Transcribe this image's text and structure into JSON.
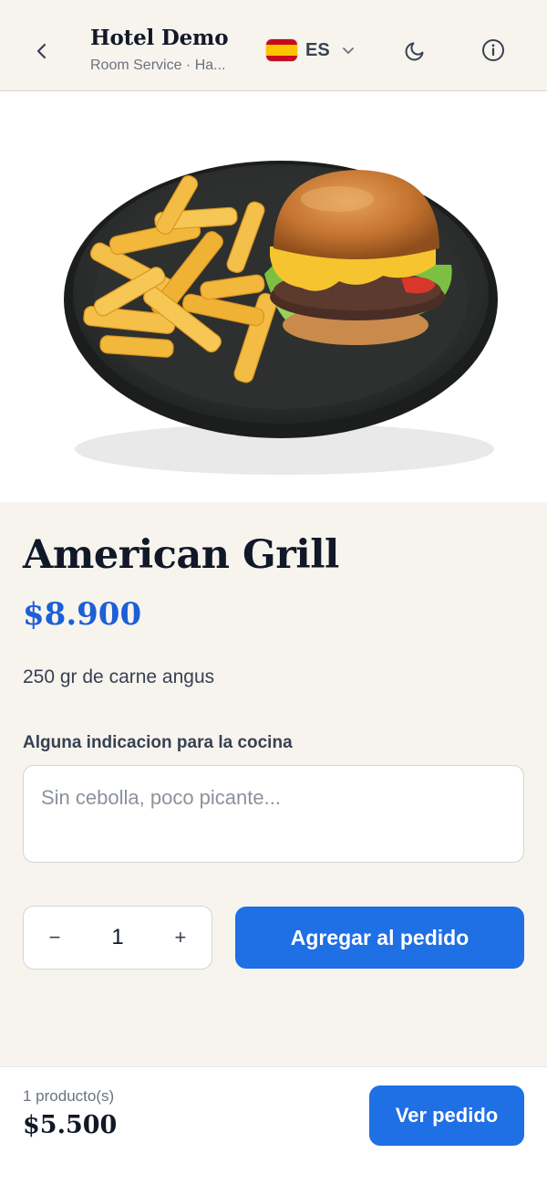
{
  "header": {
    "hotel_name": "Hotel Demo",
    "subtitle": "Room Service · Ha...",
    "language": {
      "code": "ES",
      "flag": "spain-flag"
    },
    "icons": [
      "back-icon",
      "chevron-down-icon",
      "moon-icon",
      "info-icon"
    ]
  },
  "product": {
    "image": "burger-and-fries-photo",
    "name": "American Grill",
    "price": "$8.900",
    "description": "250 gr de carne angus"
  },
  "notes": {
    "label": "Alguna indicacion para la cocina",
    "placeholder": "Sin cebolla, poco picante...",
    "value": ""
  },
  "quantity": {
    "minus_label": "−",
    "value": "1",
    "plus_label": "+"
  },
  "add_button": {
    "label": "Agregar al pedido"
  },
  "cart_bar": {
    "count_text": "1 producto(s)",
    "total": "$5.500",
    "view_button": "Ver pedido"
  },
  "colors": {
    "accent": "#1f6fe5",
    "price": "#1d5fd6",
    "background": "#f7f4ee"
  }
}
